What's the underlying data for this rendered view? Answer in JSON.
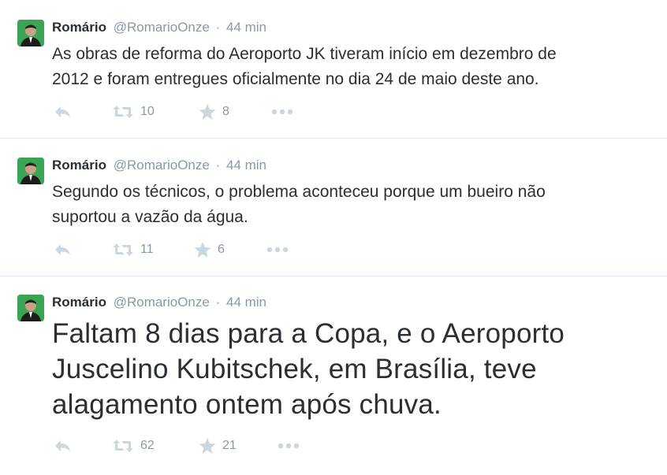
{
  "tweets": [
    {
      "name": "Romário",
      "handle": "@RomarioOnze",
      "separator": "·",
      "time": "44 min",
      "text_line1": "As obras de reforma do Aeroporto JK tiveram início em dezembro de",
      "text_line2": "2012 e foram entregues oficialmente no dia 24 de maio deste ano.",
      "text_line3": "",
      "retweets": "10",
      "favorites": "8"
    },
    {
      "name": "Romário",
      "handle": "@RomarioOnze",
      "separator": "·",
      "time": "44 min",
      "text_line1": "Segundo os técnicos, o problema aconteceu porque um bueiro não",
      "text_line2": "suportou a vazão da água.",
      "text_line3": "",
      "retweets": "11",
      "favorites": "6"
    },
    {
      "name": "Romário",
      "handle": "@RomarioOnze",
      "separator": "·",
      "time": "44 min",
      "text_line1": "Faltam 8 dias para a Copa, e o Aeroporto",
      "text_line2": "Juscelino Kubitschek, em Brasília, teve",
      "text_line3": "alagamento ontem após chuva.",
      "retweets": "62",
      "favorites": "21"
    }
  ],
  "icons": {
    "reply": "reply-icon",
    "retweet": "retweet-icon",
    "favorite": "star-icon",
    "more": "more-icon"
  },
  "colors": {
    "text": "#292f33",
    "muted": "#8899a6",
    "icon": "#ccd6dd",
    "divider": "#e1e8ed",
    "avatar_bg": "#2f9e44"
  }
}
